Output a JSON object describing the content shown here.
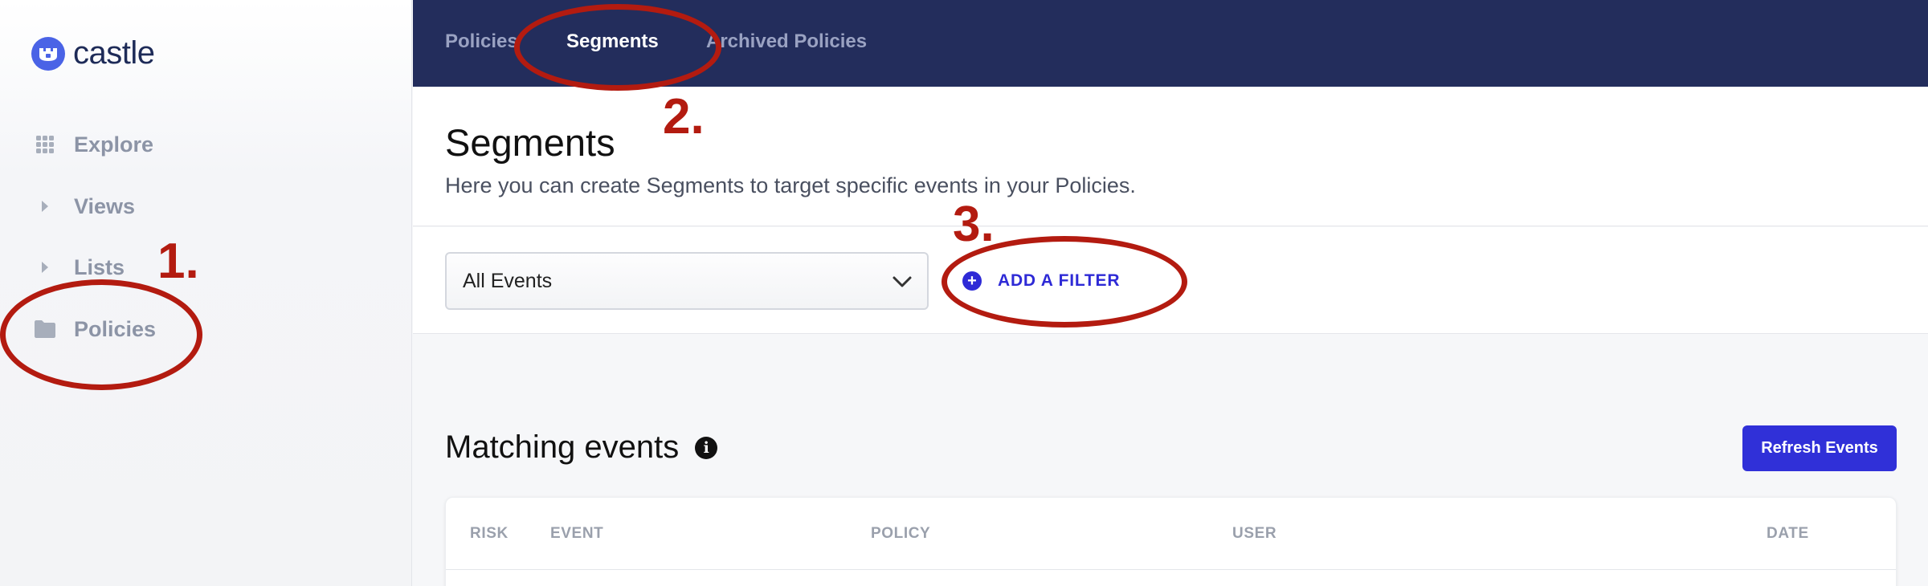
{
  "brand": {
    "name": "castle",
    "color": "#4a63e6"
  },
  "sidebar": {
    "items": [
      {
        "label": "Explore",
        "icon": "grid-icon"
      },
      {
        "label": "Views",
        "icon": "caret-right-icon"
      },
      {
        "label": "Lists",
        "icon": "caret-right-icon"
      },
      {
        "label": "Policies",
        "icon": "folder-icon"
      }
    ]
  },
  "topnav": {
    "tabs": [
      {
        "label": "Policies",
        "active": false
      },
      {
        "label": "Segments",
        "active": true
      },
      {
        "label": "Archived Policies",
        "active": false
      }
    ]
  },
  "header": {
    "title": "Segments",
    "subtitle": "Here you can create Segments to target specific events in your Policies."
  },
  "filters": {
    "select_value": "All Events",
    "add_filter_label": "ADD A FILTER"
  },
  "events": {
    "title": "Matching events",
    "refresh_label": "Refresh Events",
    "columns": [
      "RISK",
      "EVENT",
      "POLICY",
      "USER",
      "DATE"
    ]
  },
  "annotations": [
    "1.",
    "2.",
    "3."
  ],
  "colors": {
    "accent": "#3030d8",
    "topbar": "#232d5c",
    "annotation": "#b31b10"
  }
}
